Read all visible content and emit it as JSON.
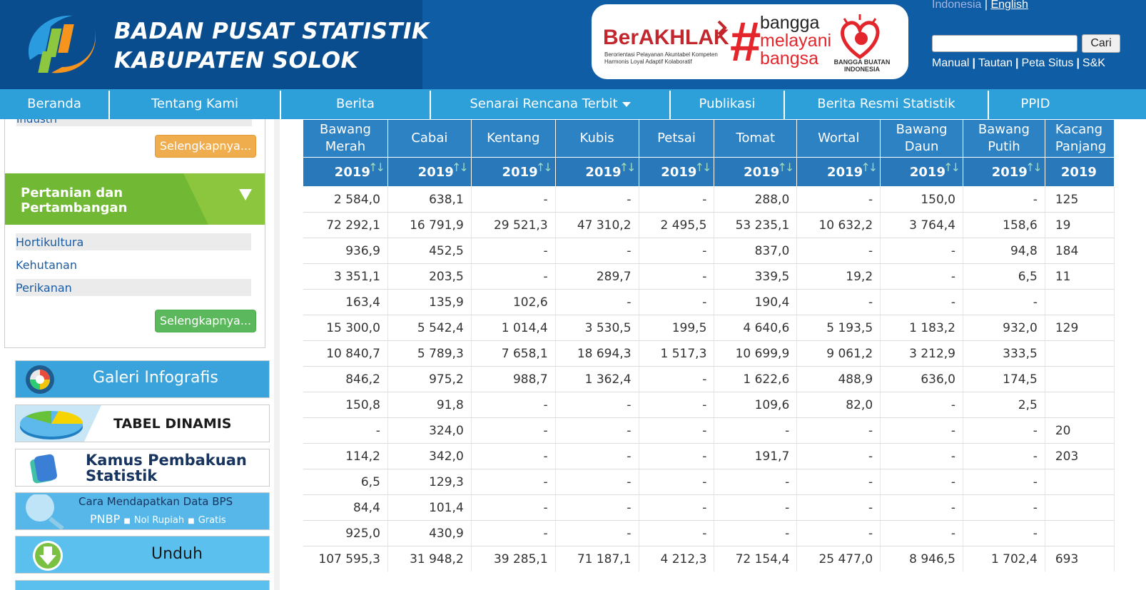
{
  "header": {
    "title_line1": "BADAN PUSAT STATISTIK",
    "title_line2": "KABUPATEN SOLOK",
    "banner": {
      "berakhlak": "BerAKHLAK",
      "berakhlak_sub1": "Berorientasi Pelayanan Akuntabel Kompeten",
      "berakhlak_sub2": "Harmonis Loyal Adaptif Kolaboratif",
      "hash": "#",
      "bangga1": "bangga",
      "bangga2": "melayani",
      "bangga3": "bangsa",
      "bbi": "BANGGA BUATAN INDONESIA"
    },
    "lang_indonesia": "Indonesia",
    "lang_sep": "|",
    "lang_english": "English",
    "search_placeholder": "",
    "search_button": "Cari",
    "links": [
      "Manual",
      "Tautan",
      "Peta Situs",
      "S&K"
    ]
  },
  "nav": [
    "Beranda",
    "Tentang Kami",
    "Berita",
    "Senarai Rencana Terbit",
    "Publikasi",
    "Berita Resmi Statistik",
    "PPID"
  ],
  "sidebar": {
    "industri": "Industri",
    "more_label": "Selengkapnya...",
    "category": "Pertanian dan Pertambangan",
    "links": [
      "Hortikultura",
      "Kehutanan",
      "Perikanan"
    ],
    "banners": {
      "galeri": "Galeri Infografis",
      "tabel": "TABEL DINAMIS",
      "kamus1": "Kamus Pembakuan",
      "kamus2": "Statistik",
      "cara1": "Cara Mendapatkan Data BPS",
      "cara2": "PNBP",
      "cara3": "Nol Rupiah",
      "cara4": "Gratis",
      "unduh": "Unduh"
    }
  },
  "table": {
    "columns": [
      "Bawang Merah",
      "Cabai",
      "Kentang",
      "Kubis",
      "Petsai",
      "Tomat",
      "Wortal",
      "Bawang Daun",
      "Bawang Putih",
      "Kacang Panjang"
    ],
    "year": "2019",
    "rows": [
      [
        "2 584,0",
        "638,1",
        "-",
        "-",
        "-",
        "288,0",
        "-",
        "150,0",
        "-",
        "125"
      ],
      [
        "72 292,1",
        "16 791,9",
        "29 521,3",
        "47 310,2",
        "2 495,5",
        "53 235,1",
        "10 632,2",
        "3 764,4",
        "158,6",
        "19"
      ],
      [
        "936,9",
        "452,5",
        "-",
        "-",
        "-",
        "837,0",
        "-",
        "-",
        "94,8",
        "184"
      ],
      [
        "3 351,1",
        "203,5",
        "-",
        "289,7",
        "-",
        "339,5",
        "19,2",
        "-",
        "6,5",
        "11"
      ],
      [
        "163,4",
        "135,9",
        "102,6",
        "-",
        "-",
        "190,4",
        "-",
        "-",
        "-",
        ""
      ],
      [
        "15 300,0",
        "5 542,4",
        "1 014,4",
        "3 530,5",
        "199,5",
        "4 640,6",
        "5 193,5",
        "1 183,2",
        "932,0",
        "129"
      ],
      [
        "10 840,7",
        "5 789,3",
        "7 658,1",
        "18 694,3",
        "1 517,3",
        "10 699,9",
        "9 061,2",
        "3 212,9",
        "333,5",
        ""
      ],
      [
        "846,2",
        "975,2",
        "988,7",
        "1 362,4",
        "-",
        "1 622,6",
        "488,9",
        "636,0",
        "174,5",
        ""
      ],
      [
        "150,8",
        "91,8",
        "-",
        "-",
        "-",
        "109,6",
        "82,0",
        "-",
        "2,5",
        ""
      ],
      [
        "-",
        "324,0",
        "-",
        "-",
        "-",
        "-",
        "-",
        "-",
        "-",
        "20"
      ],
      [
        "114,2",
        "342,0",
        "-",
        "-",
        "-",
        "191,7",
        "-",
        "-",
        "-",
        "203"
      ],
      [
        "6,5",
        "129,3",
        "-",
        "-",
        "-",
        "-",
        "-",
        "-",
        "-",
        ""
      ],
      [
        "84,4",
        "101,4",
        "-",
        "-",
        "-",
        "-",
        "-",
        "-",
        "-",
        ""
      ],
      [
        "925,0",
        "430,9",
        "-",
        "-",
        "-",
        "-",
        "-",
        "-",
        "-",
        ""
      ],
      [
        "107 595,3",
        "31 948,2",
        "39 285,1",
        "71 187,1",
        "4 212,3",
        "72 154,4",
        "25 477,0",
        "8 946,5",
        "1 702,4",
        "693"
      ]
    ]
  }
}
